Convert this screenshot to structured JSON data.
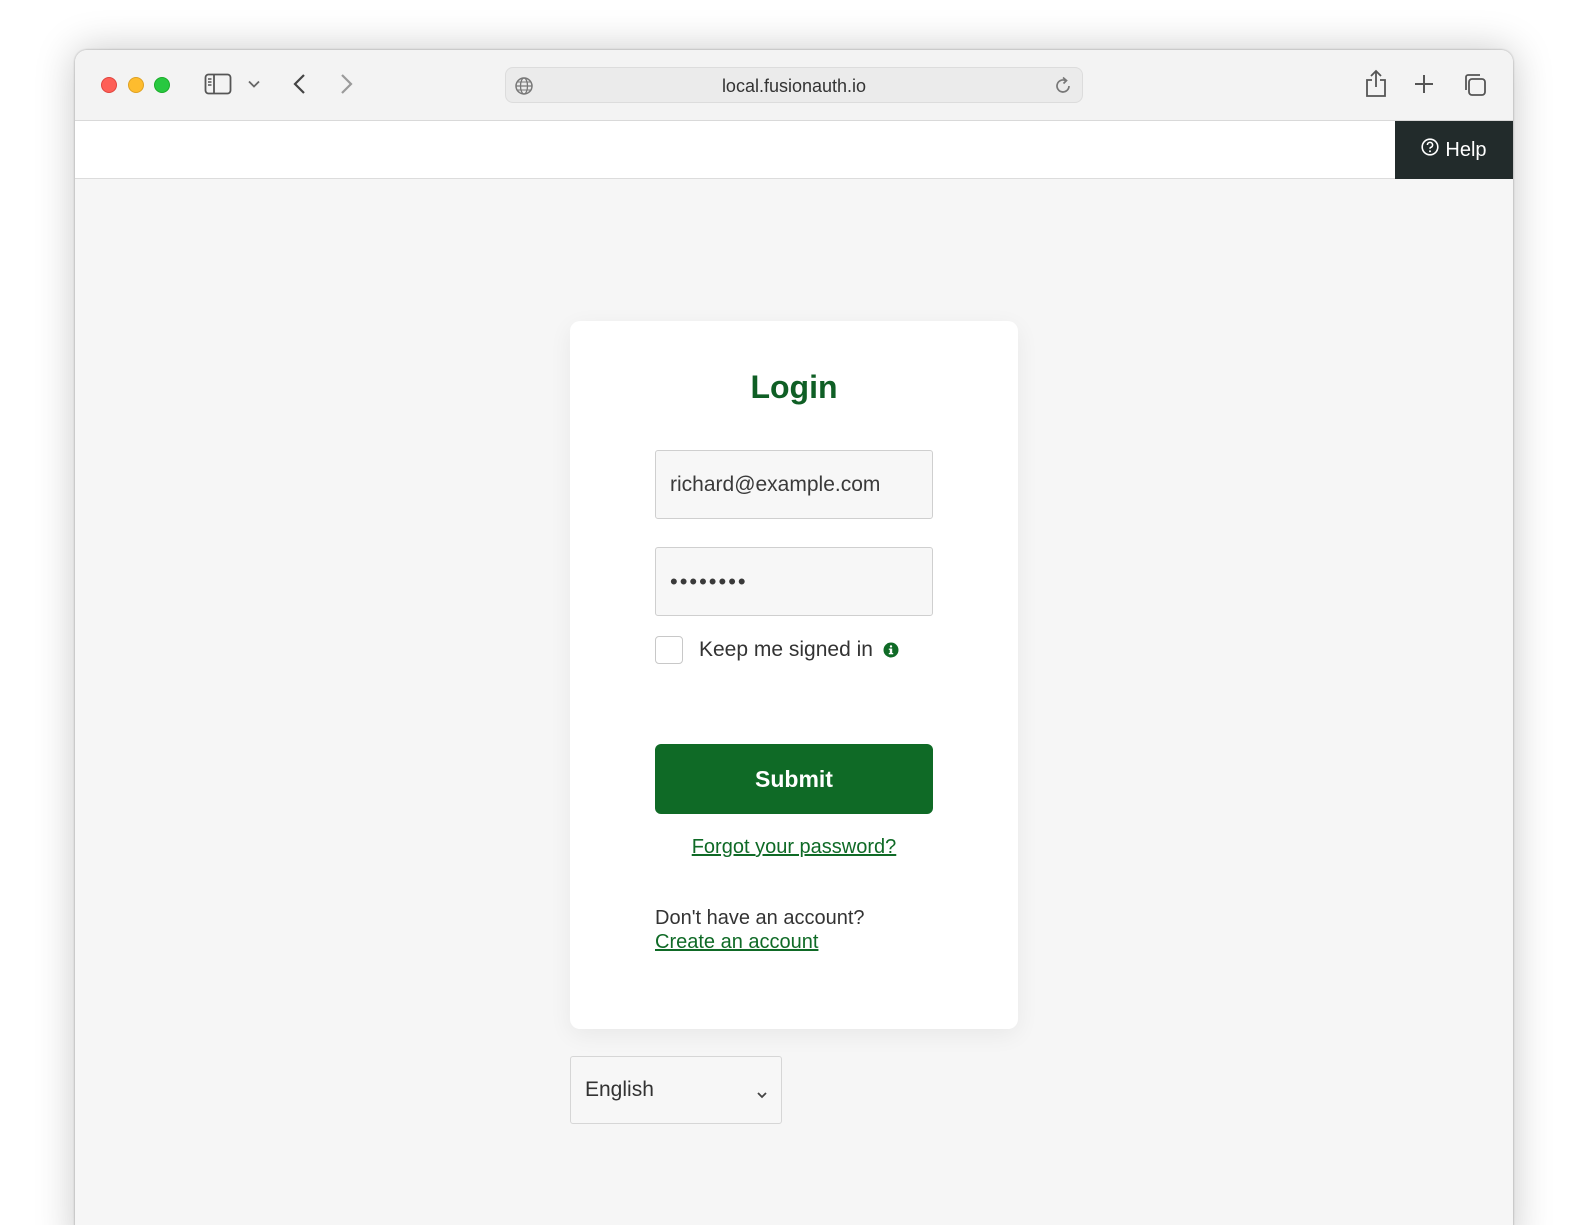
{
  "browser": {
    "url": "local.fusionauth.io",
    "icons": [
      "sidebar-icon",
      "chevron-down-icon",
      "back-icon",
      "forward-icon",
      "globe-icon",
      "reload-icon",
      "share-icon",
      "plus-icon",
      "tabs-icon"
    ]
  },
  "header": {
    "help_label": "Help",
    "help_icon": "question-circle-icon"
  },
  "login": {
    "title": "Login",
    "email_value": "richard@example.com",
    "password_value": "••••••••",
    "keep_signed_in_label": "Keep me signed in",
    "keep_signed_in_checked": false,
    "submit_label": "Submit",
    "forgot_password_label": "Forgot your password?",
    "no_account_text": "Don't have an account?",
    "create_account_label": "Create an account"
  },
  "locale": {
    "selected": "English"
  },
  "colors": {
    "brand_green": "#0f6a26",
    "title_green": "#0f5f25",
    "help_bg": "#222b2b"
  }
}
